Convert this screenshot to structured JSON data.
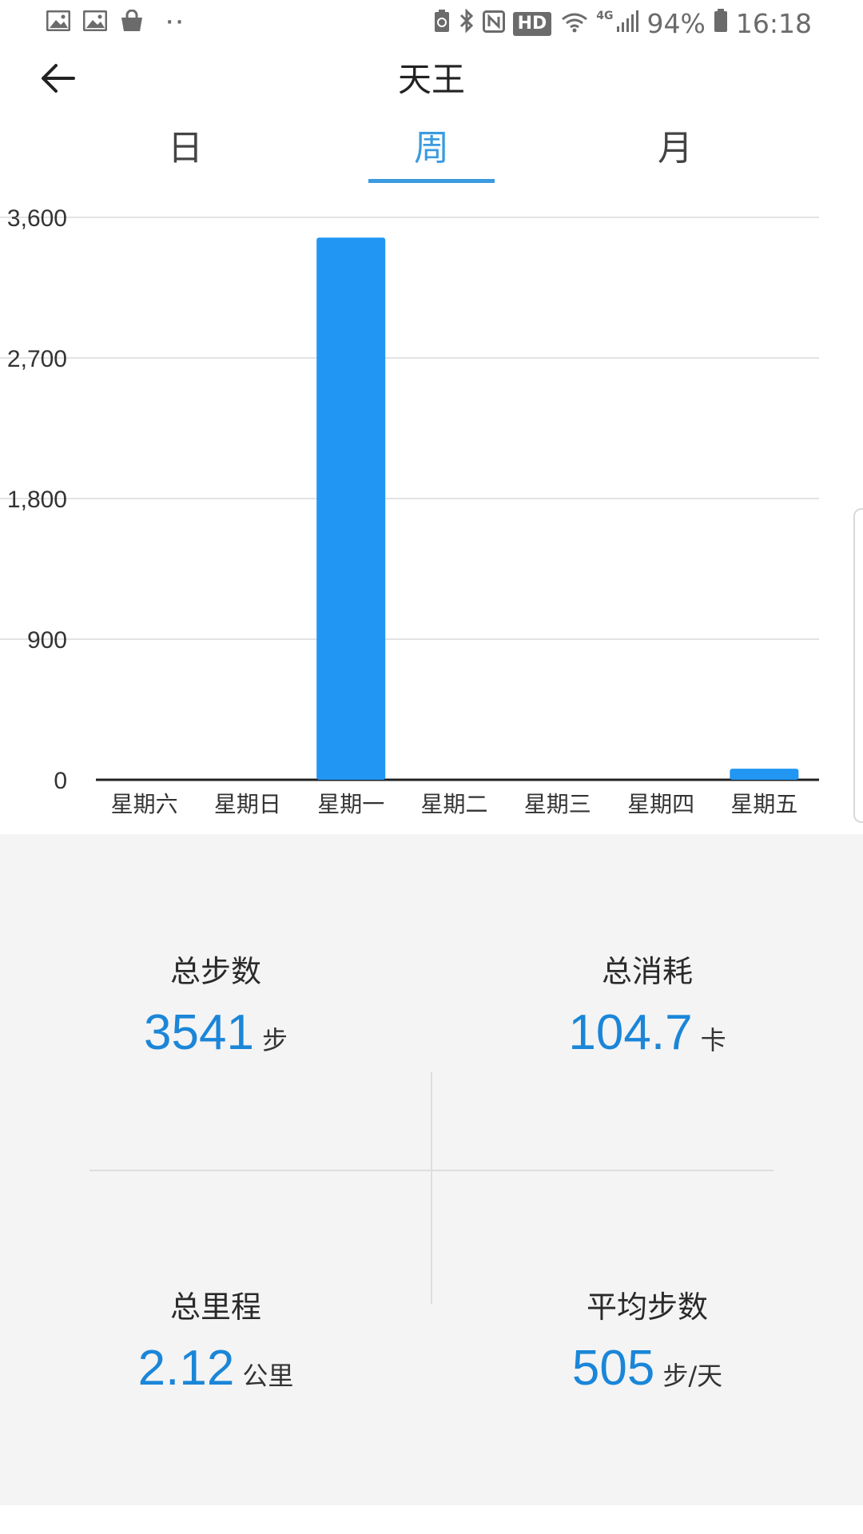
{
  "status_bar": {
    "left_icons": [
      "image-icon",
      "image-icon",
      "shopping-bag-icon",
      "more-dots-icon"
    ],
    "right_icons": [
      "battery-saver-icon",
      "bluetooth-icon",
      "nfc-icon",
      "hd-badge",
      "wifi-icon",
      "4g-icon",
      "signal-icon",
      "battery-icon"
    ],
    "hd_label": "HD",
    "network_label": "4G",
    "battery_percent": "94%",
    "time": "16:18"
  },
  "header": {
    "title": "天王"
  },
  "tabs": [
    {
      "label": "日",
      "active": false
    },
    {
      "label": "周",
      "active": true
    },
    {
      "label": "月",
      "active": false
    }
  ],
  "chart_data": {
    "type": "bar",
    "categories": [
      "星期六",
      "星期日",
      "星期一",
      "星期二",
      "星期三",
      "星期四",
      "星期五"
    ],
    "values": [
      0,
      0,
      3470,
      0,
      0,
      0,
      71
    ],
    "y_ticks": [
      "0",
      "900",
      "1,800",
      "2,700",
      "3,600"
    ],
    "y_tick_values": [
      0,
      900,
      1800,
      2700,
      3600
    ],
    "ylim": [
      0,
      3600
    ],
    "grid": true,
    "bar_color": "#2196f3",
    "title": "",
    "xlabel": "",
    "ylabel": ""
  },
  "stats": {
    "total_steps": {
      "label": "总步数",
      "value": "3541",
      "unit": "步"
    },
    "total_consumption": {
      "label": "总消耗",
      "value": "104.7",
      "unit": "卡"
    },
    "total_distance": {
      "label": "总里程",
      "value": "2.12",
      "unit": "公里"
    },
    "average_steps": {
      "label": "平均步数",
      "value": "505",
      "unit": "步/天"
    }
  },
  "colors": {
    "accent": "#3a9be0",
    "value_blue": "#1b86d8",
    "bar": "#2196f3",
    "stats_background": "#f4f4f4"
  }
}
